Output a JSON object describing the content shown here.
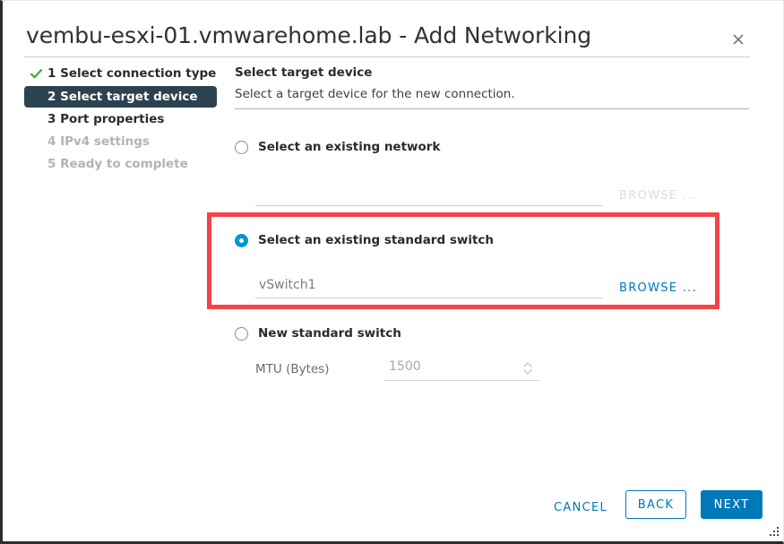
{
  "dialog": {
    "title": "vembu-esxi-01.vmwarehome.lab - Add Networking",
    "close_icon": "close-icon"
  },
  "sidebar": {
    "steps": [
      {
        "label": "1 Select connection type",
        "state": "completed"
      },
      {
        "label": "2 Select target device",
        "state": "active"
      },
      {
        "label": "3 Port properties",
        "state": "pending"
      },
      {
        "label": "4 IPv4 settings",
        "state": "disabled"
      },
      {
        "label": "5 Ready to complete",
        "state": "disabled"
      }
    ]
  },
  "main": {
    "heading": "Select target device",
    "description": "Select a target device for the new connection.",
    "options": [
      {
        "label": "Select an existing network",
        "selected": false,
        "input_value": "",
        "input_placeholder": "",
        "browse_label": "BROWSE ...",
        "browse_enabled": false
      },
      {
        "label": "Select an existing standard switch",
        "selected": true,
        "input_value": "vSwitch1",
        "input_placeholder": "",
        "browse_label": "BROWSE ...",
        "browse_enabled": true
      },
      {
        "label": "New standard switch",
        "selected": false,
        "mtu_label": "MTU (Bytes)",
        "mtu_value": "1500"
      }
    ]
  },
  "footer": {
    "cancel_label": "CANCEL",
    "back_label": "BACK",
    "next_label": "NEXT"
  },
  "colors": {
    "accent_blue": "#0079b8",
    "radio_blue": "#0096d6",
    "step_active_bg": "#2d4250",
    "check_green": "#3bb143",
    "highlight_red": "#f4424a"
  }
}
